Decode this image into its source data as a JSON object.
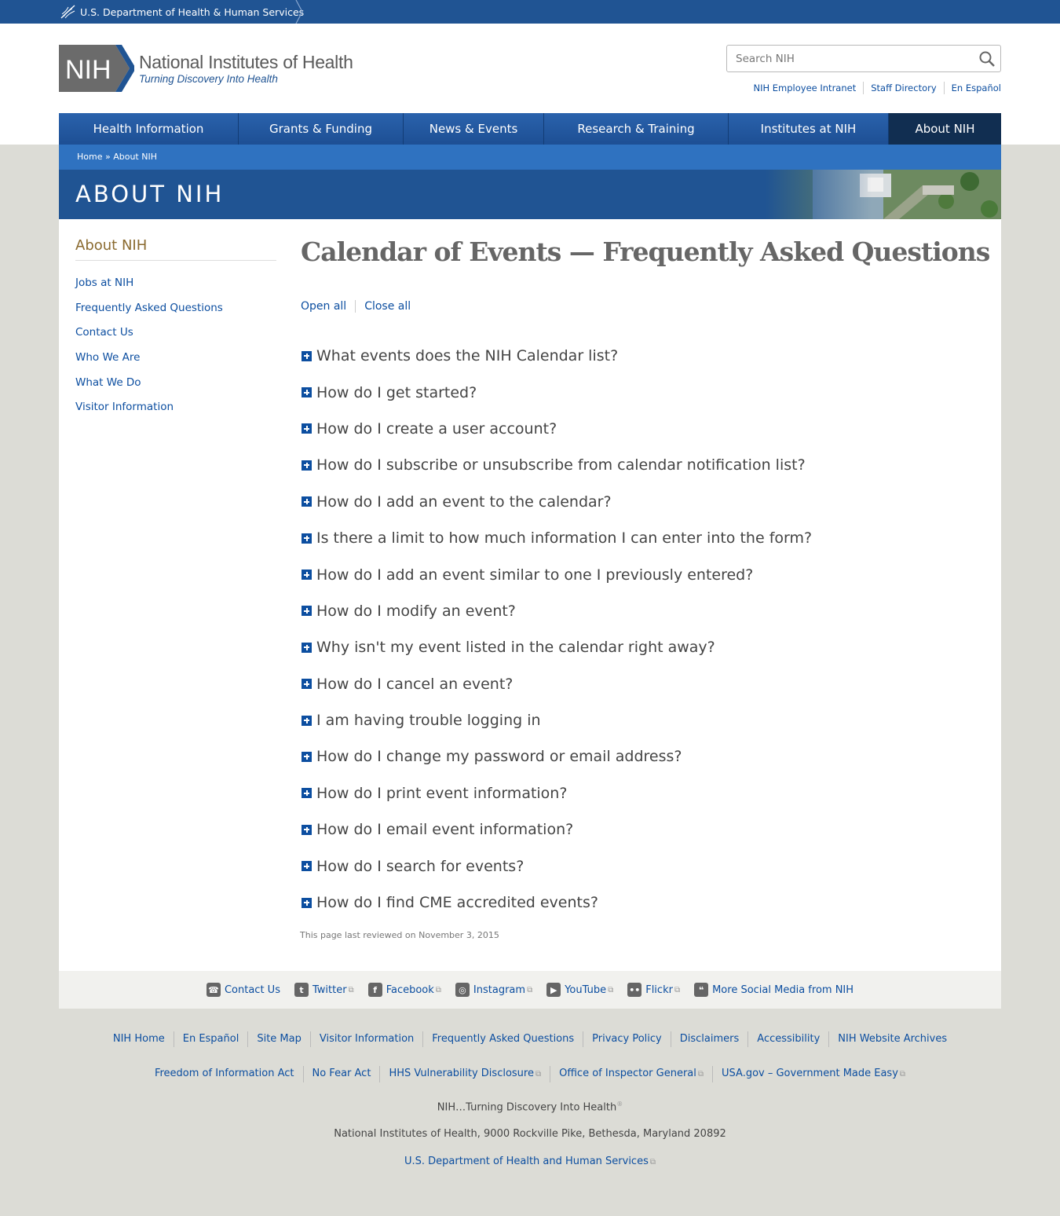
{
  "hhs_bar": {
    "label": "U.S. Department of Health & Human Services"
  },
  "logo": {
    "abbr": "NIH",
    "title": "National Institutes of Health",
    "tagline": "Turning Discovery Into Health"
  },
  "search": {
    "placeholder": "Search NIH"
  },
  "util_links": [
    "NIH Employee Intranet",
    "Staff Directory",
    "En Español"
  ],
  "nav": [
    {
      "label": "Health Information"
    },
    {
      "label": "Grants & Funding"
    },
    {
      "label": "News & Events"
    },
    {
      "label": "Research & Training"
    },
    {
      "label": "Institutes at NIH"
    },
    {
      "label": "About NIH",
      "active": true
    }
  ],
  "breadcrumb": "Home » About NIH",
  "banner_title": "ABOUT NIH",
  "sidebar": {
    "title": "About NIH",
    "items": [
      "Jobs at NIH",
      "Frequently Asked Questions",
      "Contact Us",
      "Who We Are",
      "What We Do",
      "Visitor Information"
    ]
  },
  "page_title": "Calendar of Events — Frequently Asked Questions",
  "toggles": {
    "open_all": "Open all",
    "close_all": "Close all"
  },
  "faq": [
    "What events does the NIH Calendar list?",
    "How do I get started?",
    "How do I create a user account?",
    "How do I subscribe or unsubscribe from calendar notification list?",
    "How do I add an event to the calendar?",
    "Is there a limit to how much information I can enter into the form?",
    "How do I add an event similar to one I previously entered?",
    "How do I modify an event?",
    "Why isn't my event listed in the calendar right away?",
    "How do I cancel an event?",
    "I am having trouble logging in",
    "How do I change my password or email address?",
    "How do I print event information?",
    "How do I email event information?",
    "How do I search for events?",
    "How do I find CME accredited events?"
  ],
  "last_reviewed": "This page last reviewed on November 3, 2015",
  "social": [
    {
      "label": "Contact Us",
      "icon": "phone-icon",
      "glyph": "☎"
    },
    {
      "label": "Twitter",
      "icon": "twitter-icon",
      "glyph": "t"
    },
    {
      "label": "Facebook",
      "icon": "facebook-icon",
      "glyph": "f"
    },
    {
      "label": "Instagram",
      "icon": "instagram-icon",
      "glyph": "◎"
    },
    {
      "label": "YouTube",
      "icon": "youtube-icon",
      "glyph": "▶"
    },
    {
      "label": "Flickr",
      "icon": "flickr-icon",
      "glyph": "••"
    },
    {
      "label": "More Social Media from NIH",
      "icon": "chat-icon",
      "glyph": "❝"
    }
  ],
  "footer_links_1": [
    "NIH Home",
    "En Español",
    "Site Map",
    "Visitor Information",
    "Frequently Asked Questions",
    "Privacy Policy",
    "Disclaimers",
    "Accessibility",
    "NIH Website Archives"
  ],
  "footer_links_2": [
    "Freedom of Information Act",
    "No Fear Act",
    "HHS Vulnerability Disclosure",
    "Office of Inspector General",
    "USA.gov – Government Made Easy"
  ],
  "footer_tagline": "NIH…Turning Discovery Into Health",
  "footer_tagline_mark": "®",
  "footer_address": "National Institutes of Health, 9000 Rockville Pike, Bethesda, Maryland 20892",
  "footer_hhs": "U.S. Department of Health and Human Services",
  "colors": {
    "brand_blue": "#205493",
    "link": "#0c4ea0",
    "nav_active": "#112e51",
    "sidebar_title": "#8a6a2f"
  }
}
